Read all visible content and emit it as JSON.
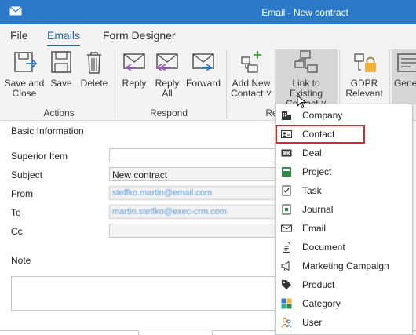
{
  "window": {
    "title": "Email - New contract"
  },
  "menu": {
    "tabs": [
      "File",
      "Emails",
      "Form Designer"
    ],
    "active_tab": "Emails"
  },
  "ribbon": {
    "buttons": {
      "save_and_close": "Save and\nClose",
      "save": "Save",
      "delete": "Delete",
      "reply": "Reply",
      "reply_all": "Reply\nAll",
      "forward": "Forward",
      "add_new_contact": "Add New\nContact ˅",
      "link_to_existing_contact": "Link to Existing\nContact ˅",
      "gdpr_relevant": "GDPR\nRelevant",
      "general": "Gener"
    },
    "groups": {
      "actions": "Actions",
      "respond": "Respond",
      "re": "Re"
    }
  },
  "form": {
    "section_title": "Basic Information",
    "fields": {
      "superior_item": {
        "label": "Superior Item",
        "value": ""
      },
      "subject": {
        "label": "Subject",
        "value": "New contract"
      },
      "from": {
        "label": "From",
        "value": "steffko.martin@email.com"
      },
      "to": {
        "label": "To",
        "value": "martin.steffko@exec-crm.com"
      },
      "cc": {
        "label": "Cc",
        "value": ""
      },
      "note": {
        "label": "Note",
        "value": ""
      }
    }
  },
  "dropdown": {
    "highlighted": "Contact",
    "items": [
      {
        "label": "Company",
        "icon": "company-icon"
      },
      {
        "label": "Contact",
        "icon": "contact-icon"
      },
      {
        "label": "Deal",
        "icon": "deal-icon"
      },
      {
        "label": "Project",
        "icon": "project-icon"
      },
      {
        "label": "Task",
        "icon": "task-icon"
      },
      {
        "label": "Journal",
        "icon": "journal-icon"
      },
      {
        "label": "Email",
        "icon": "email-icon"
      },
      {
        "label": "Document",
        "icon": "document-icon"
      },
      {
        "label": "Marketing Campaign",
        "icon": "marketing-campaign-icon"
      },
      {
        "label": "Product",
        "icon": "product-icon"
      },
      {
        "label": "Category",
        "icon": "category-icon"
      },
      {
        "label": "User",
        "icon": "user-icon"
      }
    ]
  },
  "colors": {
    "title_bar": "#2b79c7",
    "accent": "#2b63a8",
    "highlight_outline": "#cc2d2d"
  }
}
